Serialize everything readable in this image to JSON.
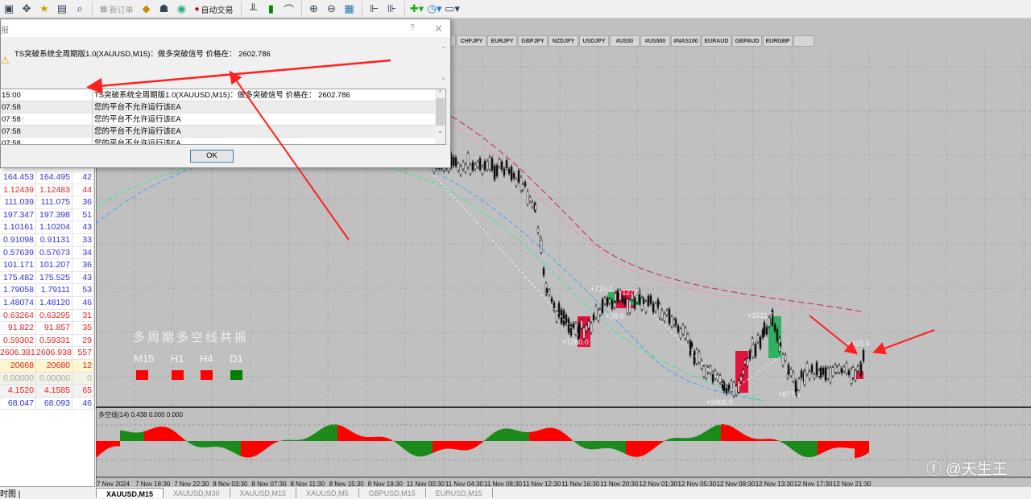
{
  "toolbar": {
    "new_order": "新订单",
    "auto_trading": "自动交易",
    "icons": [
      "chart-icon",
      "crosshair-icon",
      "favorites-icon",
      "navigator-icon",
      "tester-icon",
      "new-order-icon",
      "metaeditor-icon",
      "account-icon",
      "signals-icon",
      "autotrading-icon",
      "bar-chart-icon",
      "candle-chart-icon",
      "line-chart-icon",
      "zoom-in-icon",
      "zoom-out-icon",
      "tile-icon",
      "autoscroll-icon",
      "chart-shift-icon",
      "indicators-icon",
      "periods-icon",
      "templates-icon"
    ]
  },
  "dialog": {
    "title_fragment": "报",
    "help": "?",
    "close": "✕",
    "message": "TS突破系统全周期版1.0(XAUUSD,M15)：做多突破信号 价格在： 2602.786",
    "log": [
      {
        "time": "15:00",
        "msg": "TS突破系统全周期版1.0(XAUUSD,M15)：做多突破信号 价格在： 2602.786"
      },
      {
        "time": "07:58",
        "msg": "您的平台不允许运行该EA"
      },
      {
        "time": "07:58",
        "msg": "您的平台不允许运行该EA"
      },
      {
        "time": "07:58",
        "msg": "您的平台不允许运行该EA"
      },
      {
        "time": "07:58",
        "msg": "您的平台不允许运行该EA"
      }
    ],
    "ok": "OK"
  },
  "market_watch": {
    "rows": [
      {
        "bid": "164.453",
        "ask": "164.495",
        "spread": "42",
        "color": "#3030e0"
      },
      {
        "bid": "1.12439",
        "ask": "1.12483",
        "spread": "44",
        "color": "#e82020"
      },
      {
        "bid": "111.039",
        "ask": "111.075",
        "spread": "36",
        "color": "#3030e0"
      },
      {
        "bid": "197.347",
        "ask": "197.398",
        "spread": "51",
        "color": "#3030e0"
      },
      {
        "bid": "1.10161",
        "ask": "1.10204",
        "spread": "43",
        "color": "#3030e0"
      },
      {
        "bid": "0.91098",
        "ask": "0.91131",
        "spread": "33",
        "color": "#3030e0"
      },
      {
        "bid": "0.57639",
        "ask": "0.57673",
        "spread": "34",
        "color": "#3030e0"
      },
      {
        "bid": "101.171",
        "ask": "101.207",
        "spread": "36",
        "color": "#3030e0"
      },
      {
        "bid": "175.482",
        "ask": "175.525",
        "spread": "43",
        "color": "#3030e0"
      },
      {
        "bid": "1.79058",
        "ask": "1.79111",
        "spread": "53",
        "color": "#3030e0"
      },
      {
        "bid": "1.48074",
        "ask": "1.48120",
        "spread": "46",
        "color": "#3030e0"
      },
      {
        "bid": "0.63264",
        "ask": "0.63295",
        "spread": "31",
        "color": "#e82020"
      },
      {
        "bid": "91.822",
        "ask": "91.857",
        "spread": "35",
        "color": "#e82020"
      },
      {
        "bid": "0.59302",
        "ask": "0.59331",
        "spread": "29",
        "color": "#e82020"
      },
      {
        "bid": "2606.381",
        "ask": "2606.938",
        "spread": "557",
        "color": "#e82020"
      },
      {
        "bid": "20668",
        "ask": "20680",
        "spread": "12",
        "color": "#e82020",
        "bg": "#fdf6d0"
      },
      {
        "bid": "0.00000",
        "ask": "0.00000",
        "spread": "0",
        "color": "#aaaaaa",
        "bg": "#f2f2e6"
      },
      {
        "bid": "4.1520",
        "ask": "4.1585",
        "spread": "65",
        "color": "#e82020",
        "bg": "#f2f2f2"
      },
      {
        "bid": "68.047",
        "ask": "68.093",
        "spread": "46",
        "color": "#3030e0"
      }
    ],
    "tab": "时图"
  },
  "symbols": [
    "PY",
    "CHFJPY",
    "EURJPY",
    "GBPJPY",
    "NZDJPY",
    "USDJPY",
    "#US30",
    "#US500",
    "#NAS100",
    "EURAUD",
    "GBPAUD",
    "EURGBP"
  ],
  "chart": {
    "panel_title": "多周期多空线共振",
    "timeframes": [
      {
        "label": "M15",
        "state": "bear"
      },
      {
        "label": "H1",
        "state": "bear"
      },
      {
        "label": "H4",
        "state": "bear"
      },
      {
        "label": "D1",
        "state": "bull"
      }
    ],
    "colors": {
      "bear": "#ff0000",
      "bull": "#008000"
    },
    "annotations": [
      "+719.0",
      "+127.0",
      "+39.5",
      "+7280.0",
      "+2966.0",
      "+1511.7",
      "+877.5",
      "+415.0"
    ],
    "sub_label": "多空线(14) 0.438 0.000 0.000",
    "time_labels": [
      "7 Nov 2024",
      "7 Nov 18:30",
      "7 Nov 22:30",
      "8 Nov 03:30",
      "8 Nov 07:30",
      "8 Nov 11:30",
      "8 Nov 15:30",
      "8 Nov 19:30",
      "11 Nov 00:30",
      "11 Nov 04:30",
      "11 Nov 08:30",
      "11 Nov 12:30",
      "11 Nov 16:30",
      "11 Nov 20:30",
      "12 Nov 01:30",
      "12 Nov 05:30",
      "12 Nov 09:30",
      "12 Nov 13:30",
      "12 Nov 17:30",
      "12 Nov 21:30"
    ]
  },
  "tabs": [
    "XAUUSD,M15",
    "XAUUSD,M30",
    "XAUUSD,M15",
    "XAUUSD,M5",
    "GBPUSD,M15",
    "EURUSD,M15"
  ],
  "watermark": "@天生王"
}
